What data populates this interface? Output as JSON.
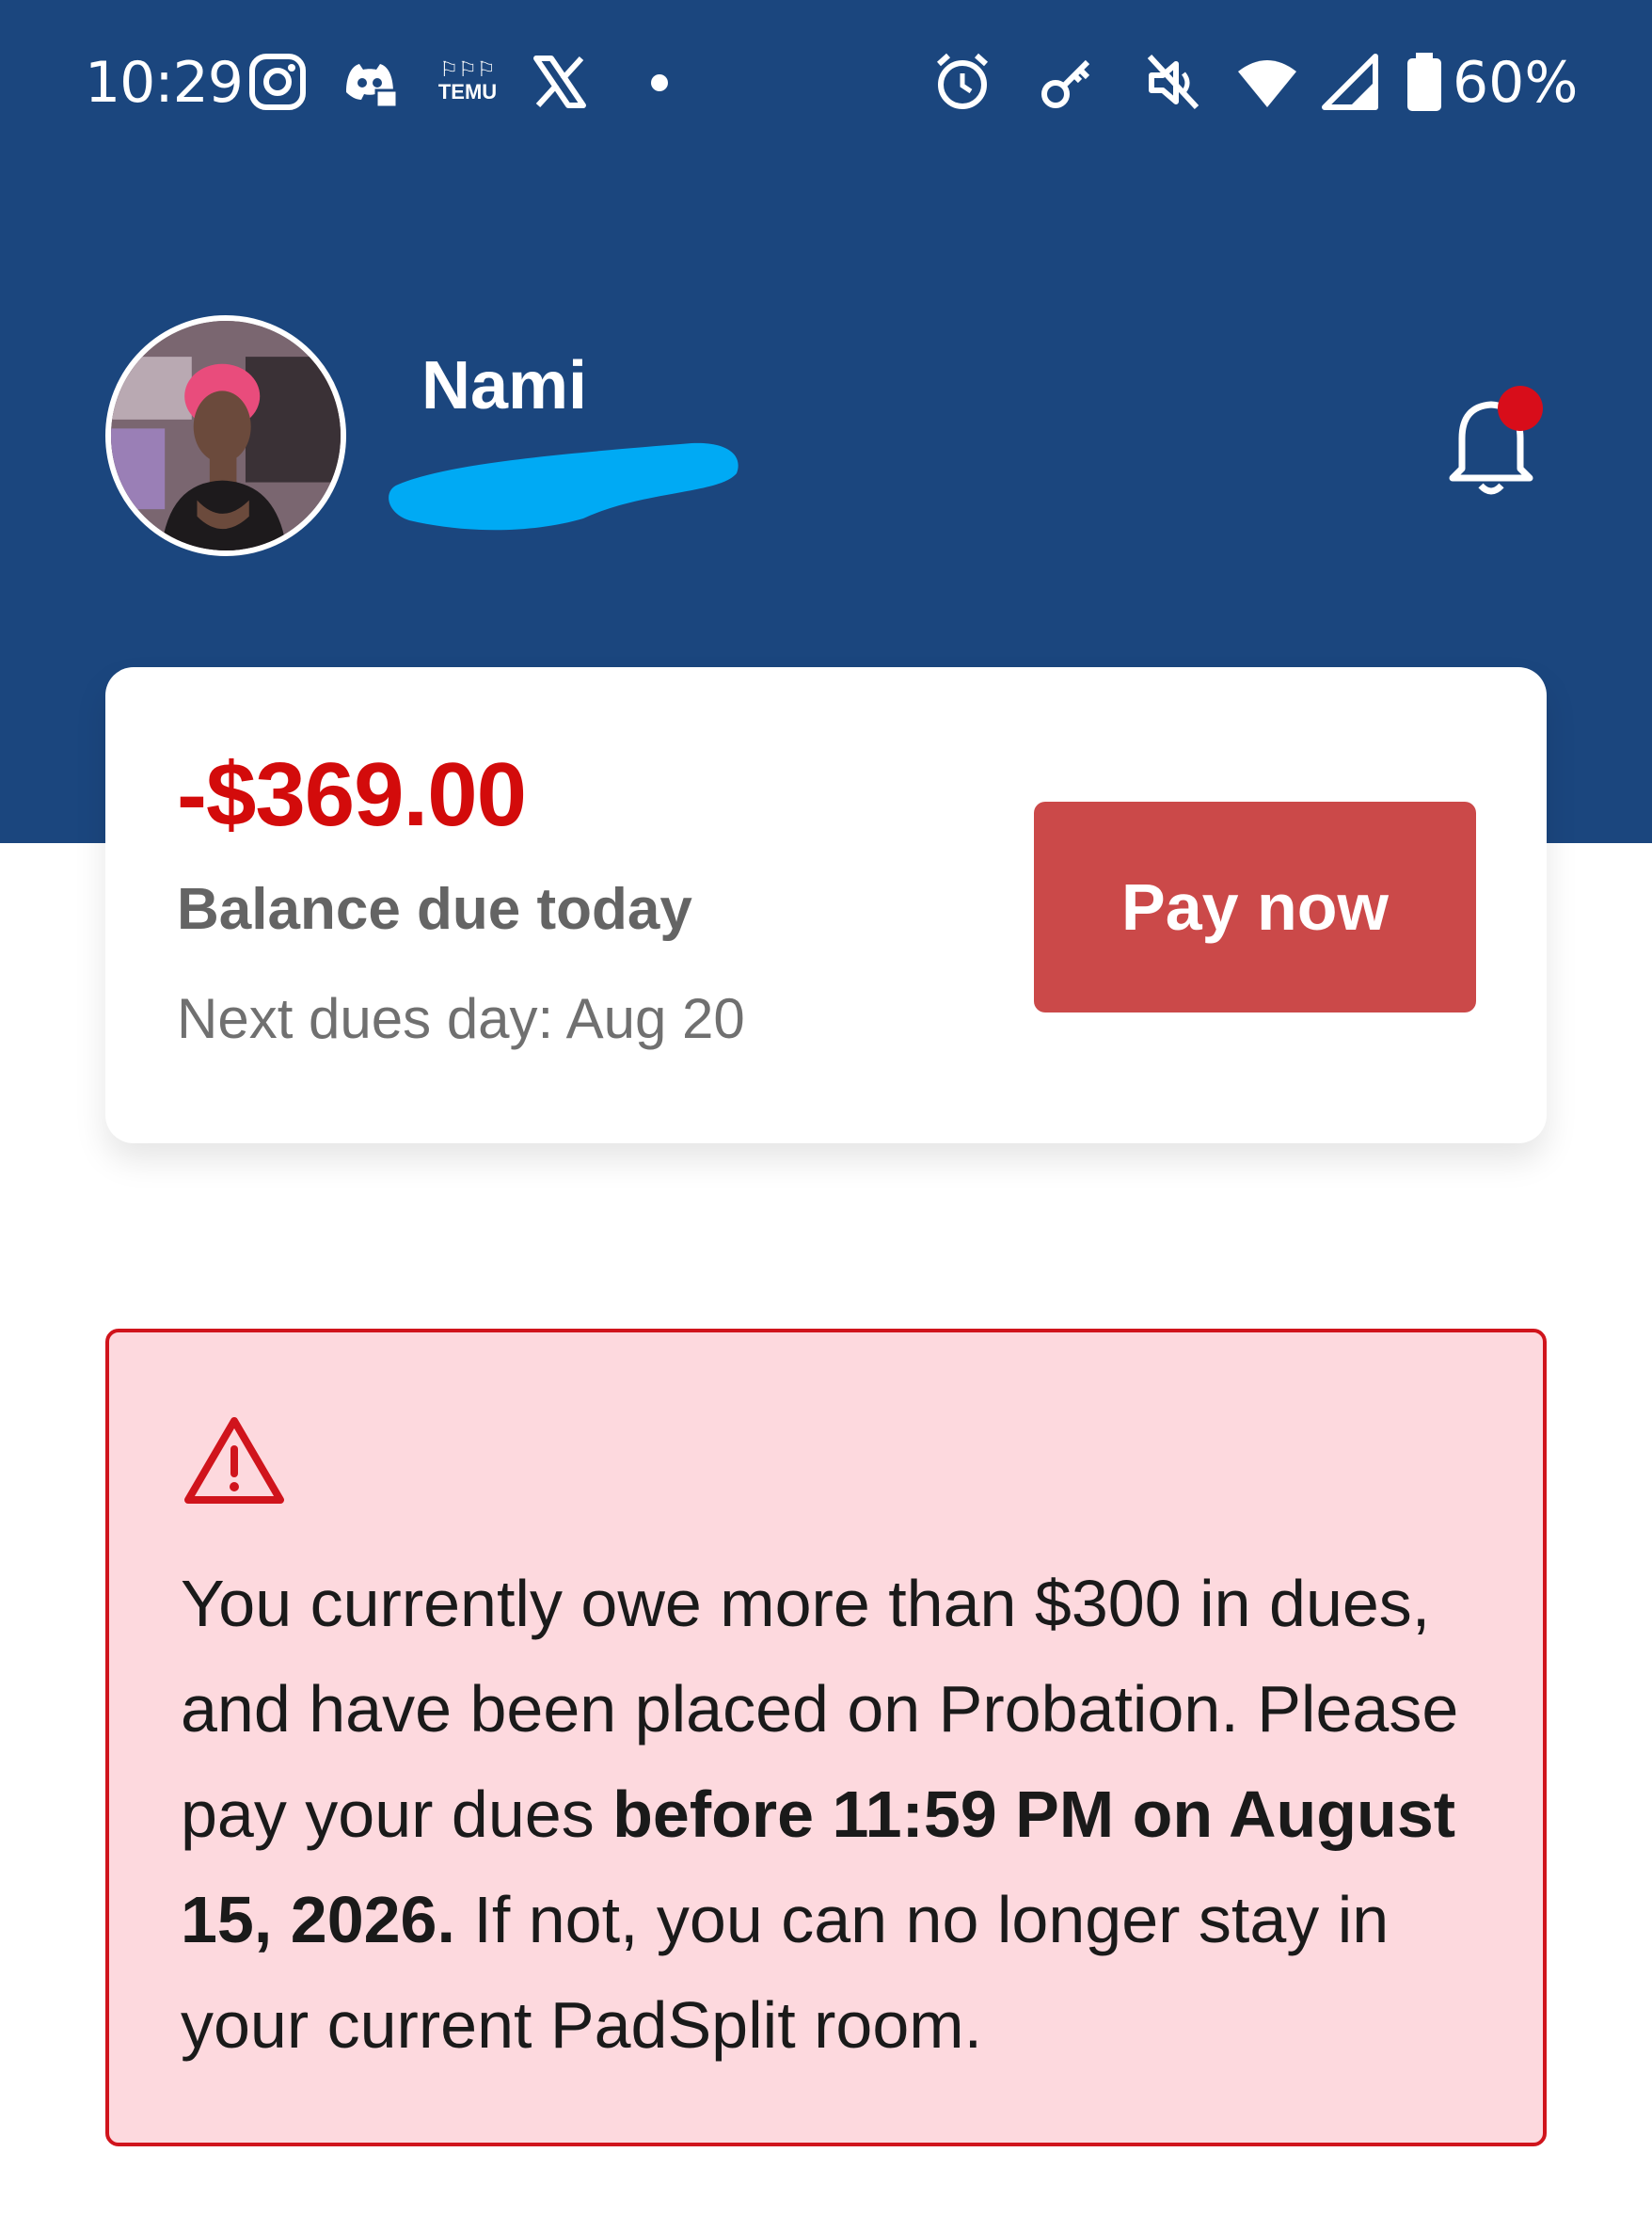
{
  "status_bar": {
    "time": "10:29",
    "icons": [
      "instagram-icon",
      "discord-icon",
      "temu-icon",
      "x-icon",
      "dot-icon",
      "alarm-icon",
      "key-icon",
      "mute-icon",
      "wifi-icon",
      "signal-icon",
      "battery-icon"
    ],
    "temu_text_top": "⚐⚐⚐",
    "temu_text": "TEMU",
    "battery": "60%"
  },
  "profile": {
    "name": "Nami",
    "notifications": {
      "has_unread": true
    }
  },
  "balance": {
    "amount": "-$369.00",
    "label": "Balance due today",
    "next_dues": "Next dues day: Aug 20",
    "pay_button": "Pay now"
  },
  "alert": {
    "icon": "warning-icon",
    "text_part1": "You currently owe more than $300 in dues, and have been placed on Probation. Please pay your dues ",
    "text_bold": "before 11:59 PM on August 15, 2026.",
    "text_part2": " If not, you can no longer stay in your current PadSplit room."
  },
  "colors": {
    "header": "#1b467e",
    "balance_red": "#d30b0b",
    "pay_button": "#cb4949",
    "alert_bg": "#fdd9de",
    "alert_border": "#d0141c",
    "notification_dot": "#d80d1a"
  }
}
